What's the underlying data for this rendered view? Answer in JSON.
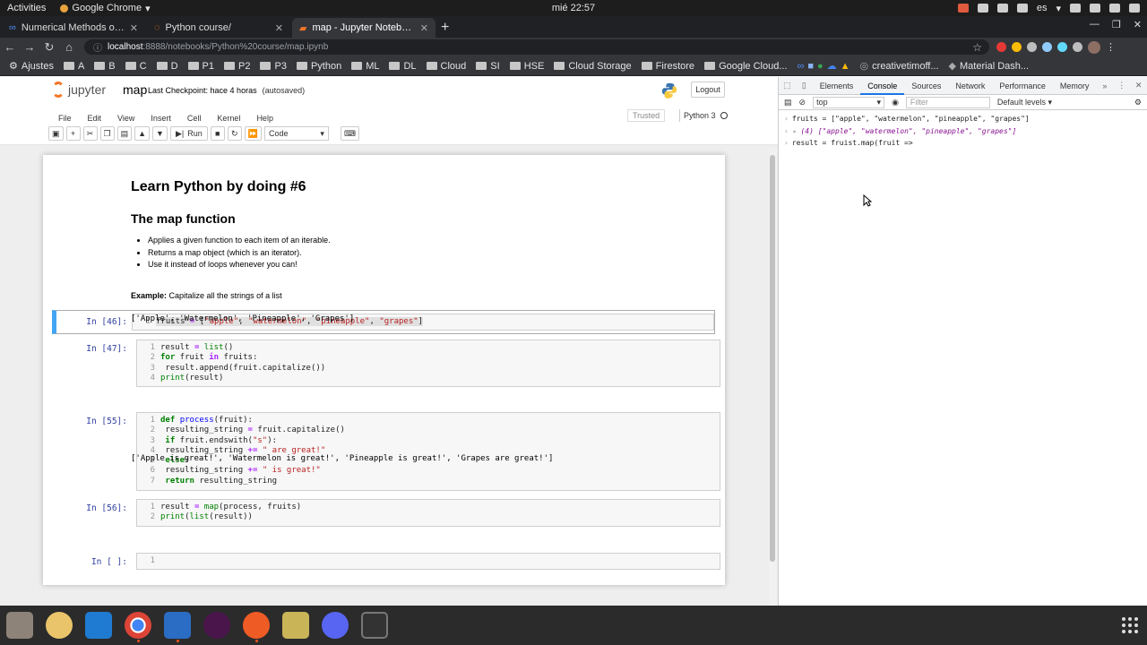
{
  "system_bar": {
    "activities": "Activities",
    "app_name": "Google Chrome",
    "clock": "mié 22:57",
    "lang": "es"
  },
  "tabs": [
    {
      "label": "Numerical Methods of Int"
    },
    {
      "label": "Python course/"
    },
    {
      "label": "map - Jupyter Notebook"
    }
  ],
  "address": {
    "host": "localhost",
    "path": ":8888/notebooks/Python%20course/map.ipynb"
  },
  "bookmarks": [
    "Ajustes",
    "A",
    "B",
    "C",
    "D",
    "P1",
    "P2",
    "P3",
    "Python",
    "ML",
    "DL",
    "Cloud",
    "SI",
    "HSE",
    "Cloud Storage",
    "Firestore",
    "Google Cloud...",
    "creativetimoff...",
    "Material Dash..."
  ],
  "jupyter": {
    "logo": "jupyter",
    "notebook_name": "map",
    "checkpoint": "Last Checkpoint: hace 4 horas",
    "autosaved": "(autosaved)",
    "logout": "Logout",
    "menu": [
      "File",
      "Edit",
      "View",
      "Insert",
      "Cell",
      "Kernel",
      "Help"
    ],
    "trusted": "Trusted",
    "kernel": "Python 3",
    "run_label": "Run",
    "cell_type": "Code"
  },
  "markdown": {
    "h1": "Learn Python by doing #6",
    "h2": "The map function",
    "bullets": [
      "Applies a given function to each item of an iterable.",
      "Returns a map object (which is an iterator).",
      "Use it instead of loops whenever you can!"
    ],
    "example_label": "Example:",
    "example_text": " Capitalize all the strings of a list"
  },
  "cells": {
    "c1": {
      "prompt": "In [46]:"
    },
    "c2": {
      "prompt": "In [47]:",
      "output": "['Apple', 'Watermelon', 'Pineapple', 'Grapes']"
    },
    "c3": {
      "prompt": "In [55]:"
    },
    "c4": {
      "prompt": "In [56]:",
      "output": "['Apple is great!', 'Watermelon is great!', 'Pineapple is great!', 'Grapes are great!']"
    },
    "c5": {
      "prompt": "In [ ]:"
    }
  },
  "devtools": {
    "tabs": [
      "Elements",
      "Console",
      "Sources",
      "Network",
      "Performance",
      "Memory"
    ],
    "context": "top",
    "filter_placeholder": "Filter",
    "levels": "Default levels ▾",
    "line1": "fruits = [\"apple\", \"watermelon\", \"pineapple\", \"grapes\"]",
    "line2_prefix": "(4)",
    "line2": "[\"apple\", \"watermelon\", \"pineapple\", \"grapes\"]",
    "line3": "result = fruist.map(fruit =>"
  },
  "colors": {
    "selected_cell_border": "#42a5f5",
    "prompt": "#303f9f",
    "keyword": "#008000",
    "string": "#ba2121"
  }
}
